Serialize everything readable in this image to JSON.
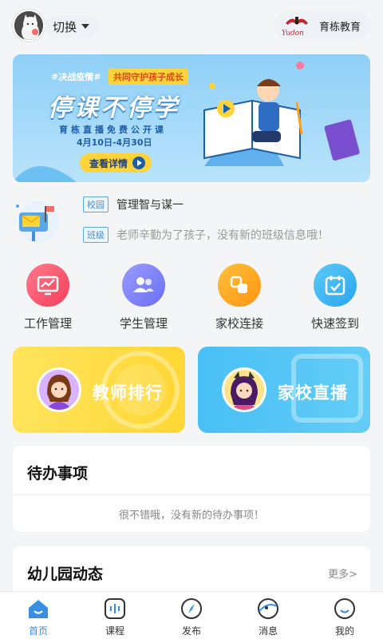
{
  "header": {
    "switch_label": "切换",
    "org_name": "育栋教育",
    "org_logo_text": "Yudon"
  },
  "banner": {
    "tag": "#决战疫情#",
    "badge": "共同守护孩子成长",
    "title": "停课不停学",
    "subtitle": "育栋直播免费公开课",
    "date_range": "4月10日-4月30日",
    "button_label": "查看详情"
  },
  "notices": [
    {
      "tag": "校园",
      "text": "管理智与谋一"
    },
    {
      "tag": "班级",
      "text": "老师辛勤为了孩子，没有新的班级信息哦！"
    }
  ],
  "grid": [
    {
      "label": "工作管理",
      "icon": "chart-icon",
      "color": "#f7526b"
    },
    {
      "label": "学生管理",
      "icon": "users-icon",
      "color": "#7b7ff5"
    },
    {
      "label": "家校连接",
      "icon": "link-squares-icon",
      "color": "#ffa31a"
    },
    {
      "label": "快速签到",
      "icon": "calendar-check-icon",
      "color": "#36b6f3"
    }
  ],
  "cards": [
    {
      "label": "教师排行",
      "color": "#ffdb3b"
    },
    {
      "label": "家校直播",
      "color": "#4ec3f5"
    }
  ],
  "todo": {
    "title": "待办事项",
    "empty": "很不错哦，没有新的待办事项！"
  },
  "news": {
    "title": "幼儿园动态",
    "more": "更多>"
  },
  "tabs": [
    {
      "label": "首页",
      "icon": "home-icon",
      "active": true
    },
    {
      "label": "课程",
      "icon": "course-icon",
      "active": false
    },
    {
      "label": "发布",
      "icon": "compass-icon",
      "active": false
    },
    {
      "label": "消息",
      "icon": "message-icon",
      "active": false
    },
    {
      "label": "我的",
      "icon": "profile-icon",
      "active": false
    }
  ],
  "colors": {
    "accent": "#3a8ee0",
    "background": "#f4f5f7"
  }
}
